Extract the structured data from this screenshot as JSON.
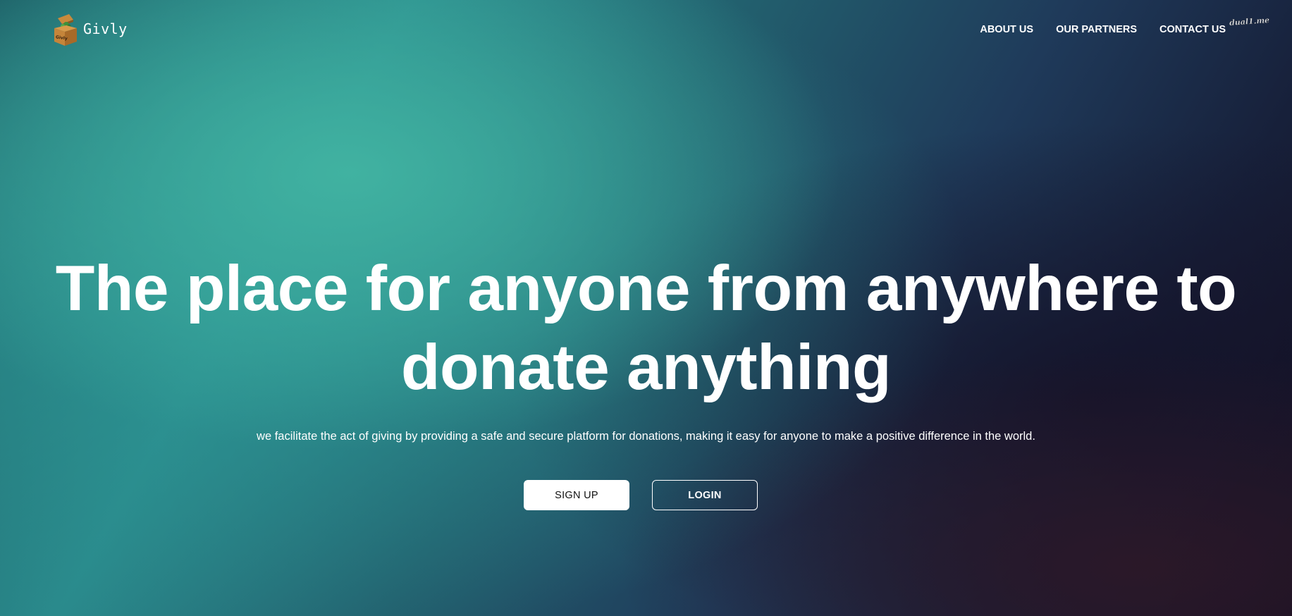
{
  "header": {
    "brand_name": "Givly",
    "logo_icon": "gift-box-icon",
    "logo_text": "Givly",
    "nav": [
      {
        "label": "ABOUT US"
      },
      {
        "label": "OUR PARTNERS"
      },
      {
        "label": "CONTACT US"
      }
    ],
    "watermark": "dual1.me"
  },
  "hero": {
    "title": "The place for anyone from anywhere to donate anything",
    "subtitle": "we facilitate the act of giving by providing a safe and secure platform for donations, making it easy for anyone to make a positive difference in the world.",
    "signup_label": "SIGN UP",
    "login_label": "LOGIN"
  },
  "colors": {
    "teal": "#3aae9e",
    "navy": "#1f2f52",
    "dark": "#140f20",
    "text": "#ffffff"
  }
}
